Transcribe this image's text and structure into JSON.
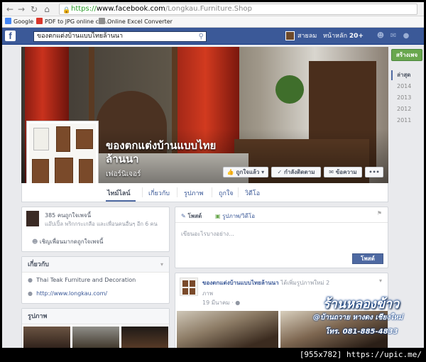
{
  "browser": {
    "url_scheme": "https://",
    "url_host": "www.facebook.com",
    "url_path": "/Longkau.Furniture.Shop",
    "bookmarks": [
      "Google",
      "PDF to JPG online con...",
      "Online Excel Converter"
    ]
  },
  "fb_nav": {
    "search_value": "ของตกแต่งบ้านแบบไทยล้านนา",
    "user_name": "สายลม",
    "home_label": "หน้าหลัก",
    "home_count": "20+"
  },
  "cover": {
    "page_name": "ของตกแต่งบ้านแบบไทยล้านนา",
    "category": "เฟอร์นิเจอร์",
    "liked_button": "ถูกใจแล้ว",
    "following_button": "กำลังติดตาม",
    "message_button": "ข้อความ",
    "more_button": "•••"
  },
  "tabs": [
    "ไทม์ไลน์",
    "เกี่ยวกับ",
    "รูปภาพ",
    "ถูกใจ",
    "วิดีโอ"
  ],
  "right_column": {
    "create_page": "สร้างเพจ",
    "years": [
      "ล่าสุด",
      "2014",
      "2013",
      "2012",
      "2011"
    ]
  },
  "likes_box": {
    "count_text": "385 คนถูกใจเพจนี้",
    "friends_text": "แอ๊ปเปิ้ล พริกกระเกลือ และเพื่อนคนอื่นๆ อีก 6 คน",
    "invite_text": "เชิญเพื่อนมากดถูกใจเพจนี้"
  },
  "about_box": {
    "title": "เกี่ยวกับ",
    "description": "Thai Teak Furniture and Decoration",
    "website": "http://www.longkau.com/"
  },
  "photos_box": {
    "title": "รูปภาพ"
  },
  "composer": {
    "tab_post": "โพสต์",
    "tab_photo": "รูปภาพ/วิดีโอ",
    "placeholder": "เขียนอะไรบางอย่าง...",
    "post_button": "โพสต์"
  },
  "feed_post": {
    "author": "ของตกแต่งบ้านแบบไทยล้านนา",
    "action_1": "ได้เพิ่มรูปภาพใหม่ 2",
    "action_2": "ภาพ",
    "date": "19 มีนาคม"
  },
  "watermark": {
    "shop": "ร้านหลองข้าว",
    "address": "@บ้านถวาย หางดง เชียงใหม่",
    "phone": "โทร. 081-885-4833"
  },
  "credit": "[955x782] https://upic.me/",
  "colors": {
    "facebook_blue": "#3b5998",
    "like_green": "#69a74e",
    "link_blue": "#3b5998"
  }
}
